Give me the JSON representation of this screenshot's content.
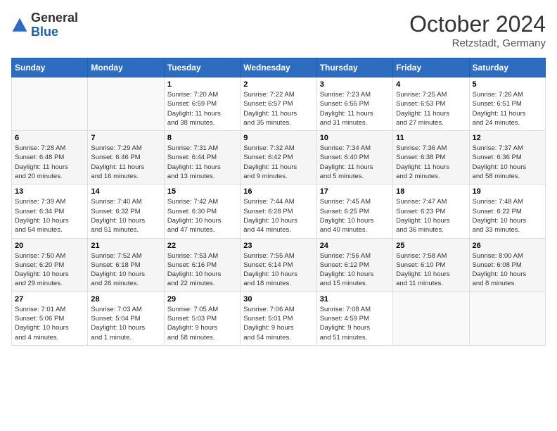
{
  "logo": {
    "general": "General",
    "blue": "Blue"
  },
  "title": "October 2024",
  "location": "Retzstadt, Germany",
  "weekdays": [
    "Sunday",
    "Monday",
    "Tuesday",
    "Wednesday",
    "Thursday",
    "Friday",
    "Saturday"
  ],
  "weeks": [
    [
      {
        "day": null,
        "info": null
      },
      {
        "day": null,
        "info": null
      },
      {
        "day": "1",
        "info": "Sunrise: 7:20 AM\nSunset: 6:59 PM\nDaylight: 11 hours\nand 38 minutes."
      },
      {
        "day": "2",
        "info": "Sunrise: 7:22 AM\nSunset: 6:57 PM\nDaylight: 11 hours\nand 35 minutes."
      },
      {
        "day": "3",
        "info": "Sunrise: 7:23 AM\nSunset: 6:55 PM\nDaylight: 11 hours\nand 31 minutes."
      },
      {
        "day": "4",
        "info": "Sunrise: 7:25 AM\nSunset: 6:53 PM\nDaylight: 11 hours\nand 27 minutes."
      },
      {
        "day": "5",
        "info": "Sunrise: 7:26 AM\nSunset: 6:51 PM\nDaylight: 11 hours\nand 24 minutes."
      }
    ],
    [
      {
        "day": "6",
        "info": "Sunrise: 7:28 AM\nSunset: 6:48 PM\nDaylight: 11 hours\nand 20 minutes."
      },
      {
        "day": "7",
        "info": "Sunrise: 7:29 AM\nSunset: 6:46 PM\nDaylight: 11 hours\nand 16 minutes."
      },
      {
        "day": "8",
        "info": "Sunrise: 7:31 AM\nSunset: 6:44 PM\nDaylight: 11 hours\nand 13 minutes."
      },
      {
        "day": "9",
        "info": "Sunrise: 7:32 AM\nSunset: 6:42 PM\nDaylight: 11 hours\nand 9 minutes."
      },
      {
        "day": "10",
        "info": "Sunrise: 7:34 AM\nSunset: 6:40 PM\nDaylight: 11 hours\nand 5 minutes."
      },
      {
        "day": "11",
        "info": "Sunrise: 7:36 AM\nSunset: 6:38 PM\nDaylight: 11 hours\nand 2 minutes."
      },
      {
        "day": "12",
        "info": "Sunrise: 7:37 AM\nSunset: 6:36 PM\nDaylight: 10 hours\nand 58 minutes."
      }
    ],
    [
      {
        "day": "13",
        "info": "Sunrise: 7:39 AM\nSunset: 6:34 PM\nDaylight: 10 hours\nand 54 minutes."
      },
      {
        "day": "14",
        "info": "Sunrise: 7:40 AM\nSunset: 6:32 PM\nDaylight: 10 hours\nand 51 minutes."
      },
      {
        "day": "15",
        "info": "Sunrise: 7:42 AM\nSunset: 6:30 PM\nDaylight: 10 hours\nand 47 minutes."
      },
      {
        "day": "16",
        "info": "Sunrise: 7:44 AM\nSunset: 6:28 PM\nDaylight: 10 hours\nand 44 minutes."
      },
      {
        "day": "17",
        "info": "Sunrise: 7:45 AM\nSunset: 6:25 PM\nDaylight: 10 hours\nand 40 minutes."
      },
      {
        "day": "18",
        "info": "Sunrise: 7:47 AM\nSunset: 6:23 PM\nDaylight: 10 hours\nand 36 minutes."
      },
      {
        "day": "19",
        "info": "Sunrise: 7:48 AM\nSunset: 6:22 PM\nDaylight: 10 hours\nand 33 minutes."
      }
    ],
    [
      {
        "day": "20",
        "info": "Sunrise: 7:50 AM\nSunset: 6:20 PM\nDaylight: 10 hours\nand 29 minutes."
      },
      {
        "day": "21",
        "info": "Sunrise: 7:52 AM\nSunset: 6:18 PM\nDaylight: 10 hours\nand 26 minutes."
      },
      {
        "day": "22",
        "info": "Sunrise: 7:53 AM\nSunset: 6:16 PM\nDaylight: 10 hours\nand 22 minutes."
      },
      {
        "day": "23",
        "info": "Sunrise: 7:55 AM\nSunset: 6:14 PM\nDaylight: 10 hours\nand 18 minutes."
      },
      {
        "day": "24",
        "info": "Sunrise: 7:56 AM\nSunset: 6:12 PM\nDaylight: 10 hours\nand 15 minutes."
      },
      {
        "day": "25",
        "info": "Sunrise: 7:58 AM\nSunset: 6:10 PM\nDaylight: 10 hours\nand 11 minutes."
      },
      {
        "day": "26",
        "info": "Sunrise: 8:00 AM\nSunset: 6:08 PM\nDaylight: 10 hours\nand 8 minutes."
      }
    ],
    [
      {
        "day": "27",
        "info": "Sunrise: 7:01 AM\nSunset: 5:06 PM\nDaylight: 10 hours\nand 4 minutes."
      },
      {
        "day": "28",
        "info": "Sunrise: 7:03 AM\nSunset: 5:04 PM\nDaylight: 10 hours\nand 1 minute."
      },
      {
        "day": "29",
        "info": "Sunrise: 7:05 AM\nSunset: 5:03 PM\nDaylight: 9 hours\nand 58 minutes."
      },
      {
        "day": "30",
        "info": "Sunrise: 7:06 AM\nSunset: 5:01 PM\nDaylight: 9 hours\nand 54 minutes."
      },
      {
        "day": "31",
        "info": "Sunrise: 7:08 AM\nSunset: 4:59 PM\nDaylight: 9 hours\nand 51 minutes."
      },
      {
        "day": null,
        "info": null
      },
      {
        "day": null,
        "info": null
      }
    ]
  ]
}
